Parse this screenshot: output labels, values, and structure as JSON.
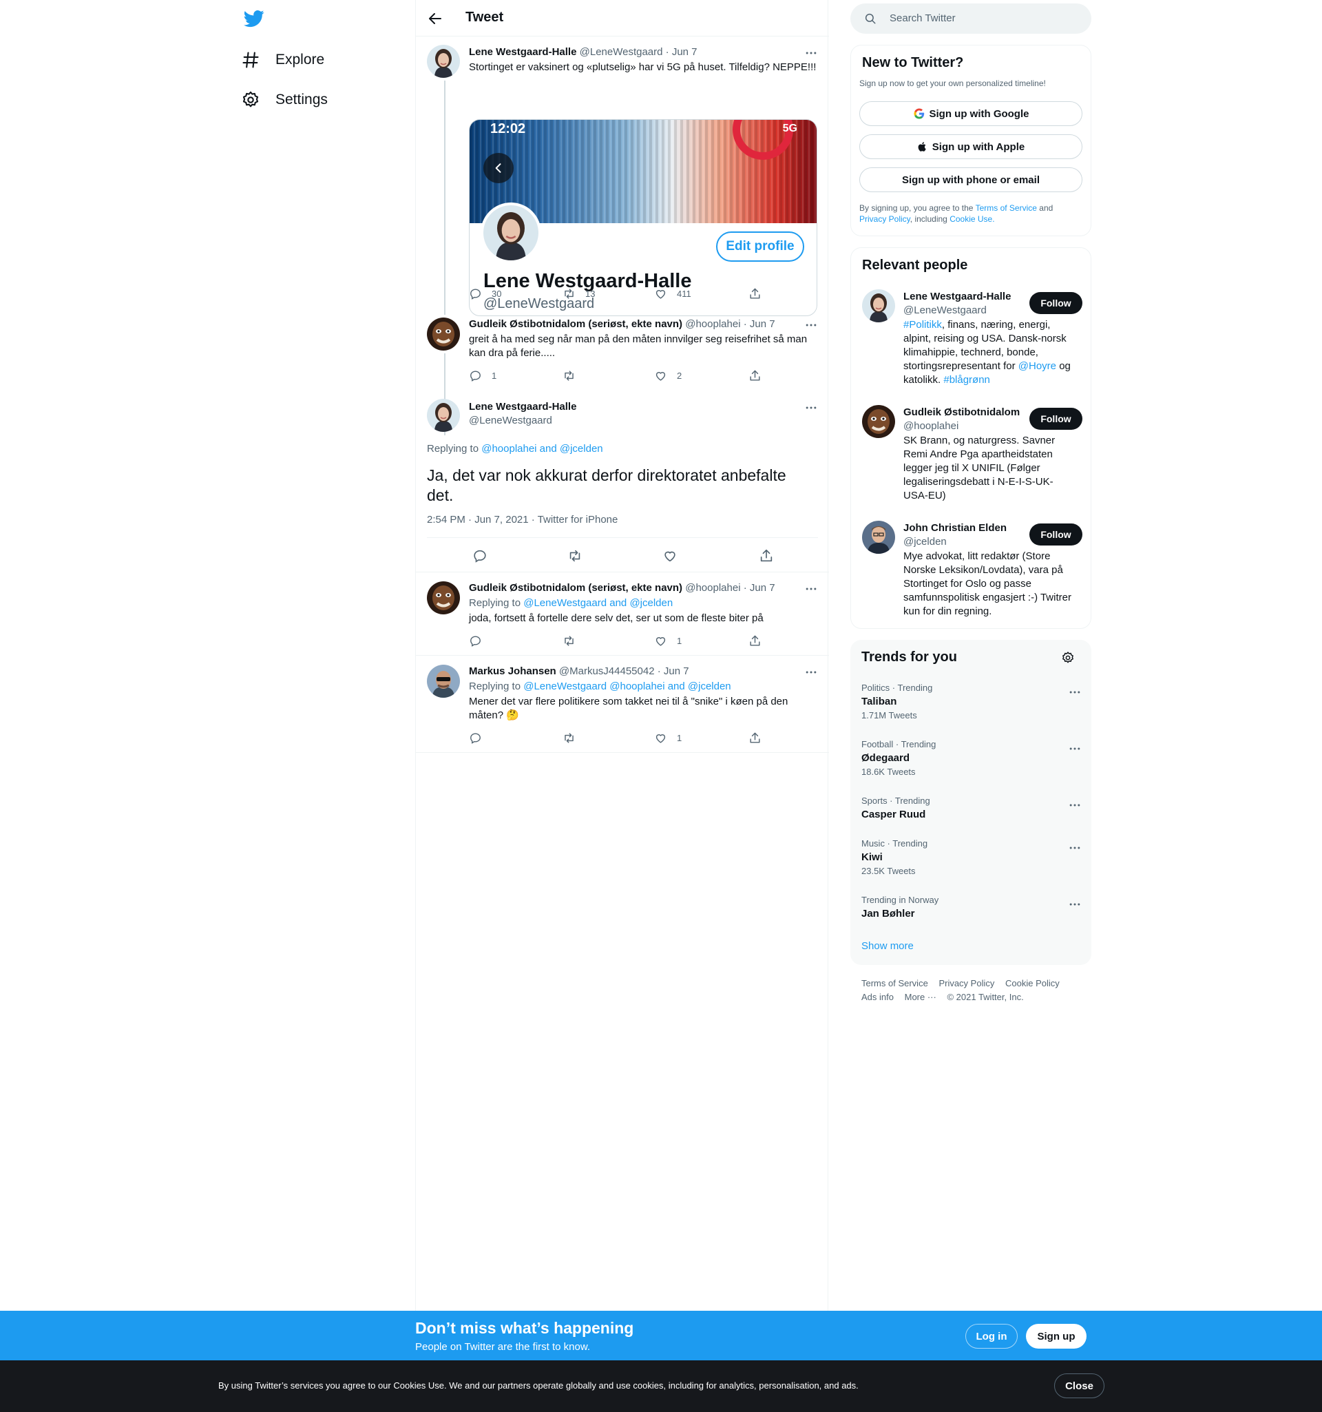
{
  "nav": {
    "explore_label": "Explore",
    "settings_label": "Settings"
  },
  "header": {
    "title": "Tweet"
  },
  "tweets": [
    {
      "name": "Lene Westgaard-Halle",
      "handle": "@LeneWestgaard",
      "date": "· Jun 7",
      "text": "Stortinget er vaksinert og «plutselig» har vi 5G på huset. Tilfeldig? NEPPE!!!",
      "card": {
        "time": "12:02",
        "network": "5G",
        "edit_label": "Edit profile",
        "name": "Lene Westgaard-Halle",
        "handle": "@LeneWestgaard"
      },
      "replies": "30",
      "retweets": "13",
      "likes": "411"
    },
    {
      "name": "Gudleik Østibotnidalom (seriøst, ekte navn)",
      "handle": "@hooplahei",
      "date": "· Jun 7",
      "text": "greit å ha med seg når man på den måten innvilger seg reisefrihet så man kan dra på ferie.....",
      "replies": "1",
      "retweets": "",
      "likes": "2"
    },
    {
      "name": "Gudleik Østibotnidalom (seriøst, ekte navn)",
      "handle": "@hooplahei",
      "date": "· Jun 7",
      "replying_prefix": "Replying to",
      "replying_to": "@LeneWestgaard and @jcelden",
      "text": "joda, fortsett å fortelle dere selv det, ser ut som de fleste biter på",
      "replies": "",
      "retweets": "",
      "likes": "1"
    },
    {
      "name": "Markus Johansen",
      "handle": "@MarkusJ44455042",
      "date": "· Jun 7",
      "replying_prefix": "Replying to",
      "replying_to": "@LeneWestgaard @hooplahei and @jcelden",
      "text": "Mener det var flere politikere som takket nei til å \"snike\" i køen på den måten? 🤔",
      "replies": "",
      "retweets": "",
      "likes": "1"
    }
  ],
  "focus": {
    "name": "Lene Westgaard-Halle",
    "handle": "@LeneWestgaard",
    "replying_prefix": "Replying to",
    "replying_to": "@hooplahei and @jcelden",
    "text": "Ja, det var nok akkurat derfor direktoratet anbefalte det.",
    "meta": "2:54 PM · Jun 7, 2021 · Twitter for iPhone"
  },
  "search": {
    "placeholder": "Search Twitter"
  },
  "new_to_twitter": {
    "title": "New to Twitter?",
    "subtitle": "Sign up now to get your own personalized timeline!",
    "google": "Sign up with Google",
    "apple": "Sign up with Apple",
    "phone": "Sign up with phone or email",
    "terms_1": "By signing up, you agree to the",
    "terms_link": "Terms of Service",
    "terms_2": "and",
    "privacy_link": "Privacy Policy",
    "terms_3": ", including",
    "cookie_link": "Cookie Use."
  },
  "relevant": {
    "title": "Relevant people",
    "follow_label": "Follow",
    "people": [
      {
        "name": "Lene Westgaard-Halle",
        "handle": "@LeneWestgaard",
        "bio_tag": "#Politikk",
        "bio_1": ", finans, næring, energi, alpint, reising og USA. Dansk-norsk klimahippie, technerd, bonde, stortingsrepresentant for",
        "bio_link": "@Hoyre",
        "bio_2": "og katolikk.",
        "bio_tag2": "#blågrønn"
      },
      {
        "name": "Gudleik Østibotnidalom",
        "handle": "@hooplahei",
        "bio": "SK Brann, og naturgress. Savner Remi Andre Pga apartheidstaten legger jeg til X UNIFIL (Følger legaliseringsdebatt i N-E-I-S-UK-USA-EU)"
      },
      {
        "name": "John Christian Elden",
        "handle": "@jcelden",
        "bio": "Mye advokat, litt redaktør (Store Norske Leksikon/Lovdata), vara på Stortinget for Oslo og passe samfunnspolitisk engasjert :-) Twitrer kun for din regning."
      }
    ]
  },
  "trends": {
    "title": "Trends for you",
    "items": [
      {
        "context": "Politics · Trending",
        "name": "Taliban",
        "count": "1.71M Tweets"
      },
      {
        "context": "Football · Trending",
        "name": "Ødegaard",
        "count": "18.6K Tweets"
      },
      {
        "context": "Sports · Trending",
        "name": "Casper Ruud",
        "count": ""
      },
      {
        "context": "Music · Trending",
        "name": "Kiwi",
        "count": "23.5K Tweets"
      },
      {
        "context": "Trending in Norway",
        "name": "Jan Bøhler",
        "count": ""
      }
    ],
    "show_more": "Show more"
  },
  "footer": {
    "tos": "Terms of Service",
    "privacy": "Privacy Policy",
    "cookie": "Cookie Policy",
    "ads": "Ads info",
    "more": "More ···",
    "copyright": "© 2021 Twitter, Inc."
  },
  "signup_bar": {
    "title": "Don’t miss what’s happening",
    "subtitle": "People on Twitter are the first to know.",
    "login": "Log in",
    "signup": "Sign up"
  },
  "cookie_bar": {
    "text": "By using Twitter’s services you agree to our Cookies Use. We and our partners operate globally and use cookies, including for analytics, personalisation, and ads.",
    "close": "Close"
  },
  "colors": {
    "accent": "#1d9bf0",
    "text": "#0f1419",
    "muted": "#536471",
    "border": "#eff3f4",
    "dark": "#16181c"
  }
}
